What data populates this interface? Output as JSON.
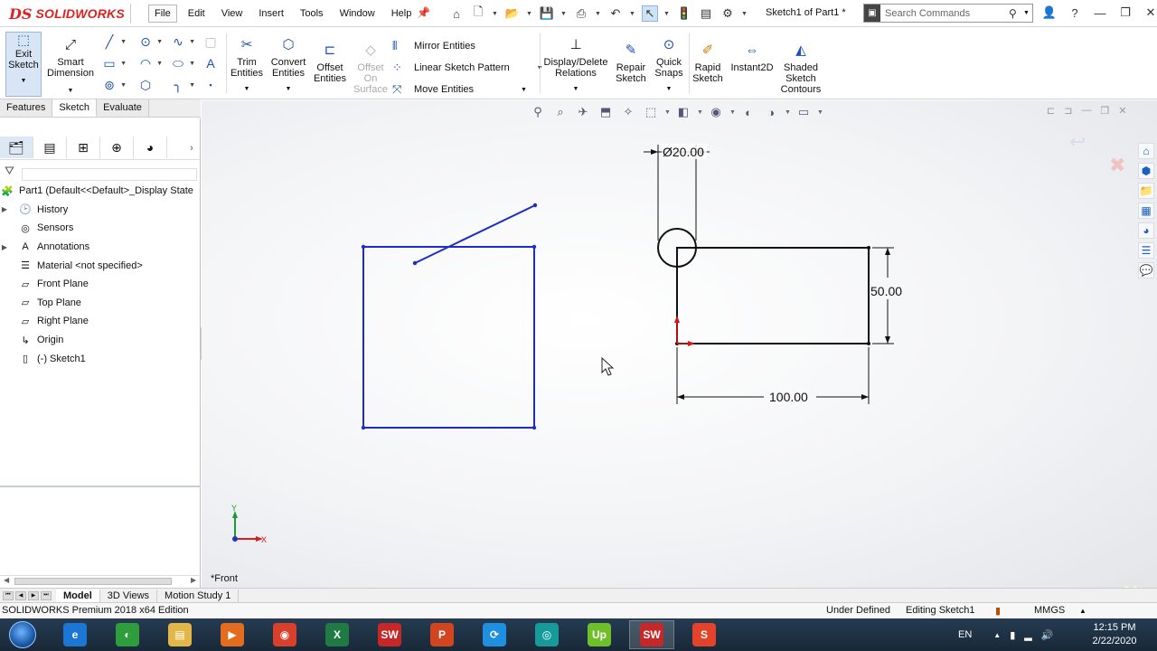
{
  "app": {
    "logo_ds": "DS",
    "logo_name": "SOLIDWORKS",
    "document_title": "Sketch1 of Part1 *"
  },
  "menu": [
    "File",
    "Edit",
    "View",
    "Insert",
    "Tools",
    "Window",
    "Help"
  ],
  "search": {
    "placeholder": "Search Commands"
  },
  "ribbon": {
    "exit_sketch": "Exit Sketch",
    "smart_dimension": "Smart Dimension",
    "trim_entities": "Trim Entities",
    "convert_entities": "Convert Entities",
    "offset_entities": "Offset Entities",
    "offset_on_surface": "Offset On Surface",
    "mirror_entities": "Mirror Entities",
    "linear_sketch_pattern": "Linear Sketch Pattern",
    "move_entities": "Move Entities",
    "display_delete_relations": "Display/Delete Relations",
    "repair_sketch": "Repair Sketch",
    "quick_snaps": "Quick Snaps",
    "rapid_sketch": "Rapid Sketch",
    "instant2d": "Instant2D",
    "shaded_sketch_contours": "Shaded Sketch Contours"
  },
  "tabs": [
    "Features",
    "Sketch",
    "Evaluate"
  ],
  "tree": {
    "root": "Part1  (Default<<Default>_Display State",
    "items": [
      {
        "label": "History",
        "icon": "history-icon",
        "expand": true
      },
      {
        "label": "Sensors",
        "icon": "sensors-icon",
        "expand": false
      },
      {
        "label": "Annotations",
        "icon": "annotations-icon",
        "expand": true
      },
      {
        "label": "Material <not specified>",
        "icon": "material-icon",
        "expand": false
      },
      {
        "label": "Front Plane",
        "icon": "plane-icon",
        "expand": false
      },
      {
        "label": "Top Plane",
        "icon": "plane-icon",
        "expand": false
      },
      {
        "label": "Right Plane",
        "icon": "plane-icon",
        "expand": false
      },
      {
        "label": "Origin",
        "icon": "origin-icon",
        "expand": false
      },
      {
        "label": "(-) Sketch1",
        "icon": "sketch-icon",
        "expand": false
      }
    ]
  },
  "graphics": {
    "view_label": "*Front",
    "dimensions": {
      "diameter": "Ø20.00",
      "height": "50.00",
      "width": "100.00"
    },
    "triad_y": "Y",
    "triad_x": "X"
  },
  "bottom_tabs": [
    "Model",
    "3D Views",
    "Motion Study 1"
  ],
  "status": {
    "edition": "SOLIDWORKS Premium 2018 x64 Edition",
    "state": "Under Defined",
    "editing": "Editing Sketch1",
    "units": "MMGS"
  },
  "taskbar": {
    "apps": [
      {
        "name": "internet-explorer",
        "label": "e",
        "color": "#1c77d4"
      },
      {
        "name": "chrome-like",
        "label": "◐",
        "color": "#2e9e3c"
      },
      {
        "name": "file-explorer",
        "label": "▤",
        "color": "#e3b64a"
      },
      {
        "name": "media-player",
        "label": "▶",
        "color": "#e46c1e"
      },
      {
        "name": "chrome",
        "label": "◉",
        "color": "#d9402c"
      },
      {
        "name": "excel",
        "label": "X",
        "color": "#1f7a44"
      },
      {
        "name": "solidworks-2018",
        "label": "SW",
        "color": "#c62828"
      },
      {
        "name": "powerpoint",
        "label": "P",
        "color": "#d1461f"
      },
      {
        "name": "sync-app",
        "label": "⟳",
        "color": "#1f8fe0"
      },
      {
        "name": "video-app",
        "label": "◎",
        "color": "#179a9a"
      },
      {
        "name": "upwork",
        "label": "Up",
        "color": "#6fbf2a"
      },
      {
        "name": "solidworks-2018-active",
        "label": "SW",
        "color": "#c62828"
      },
      {
        "name": "s-app",
        "label": "S",
        "color": "#e4432b"
      }
    ],
    "lang": "EN",
    "time": "12:15 PM",
    "date": "2/22/2020"
  }
}
